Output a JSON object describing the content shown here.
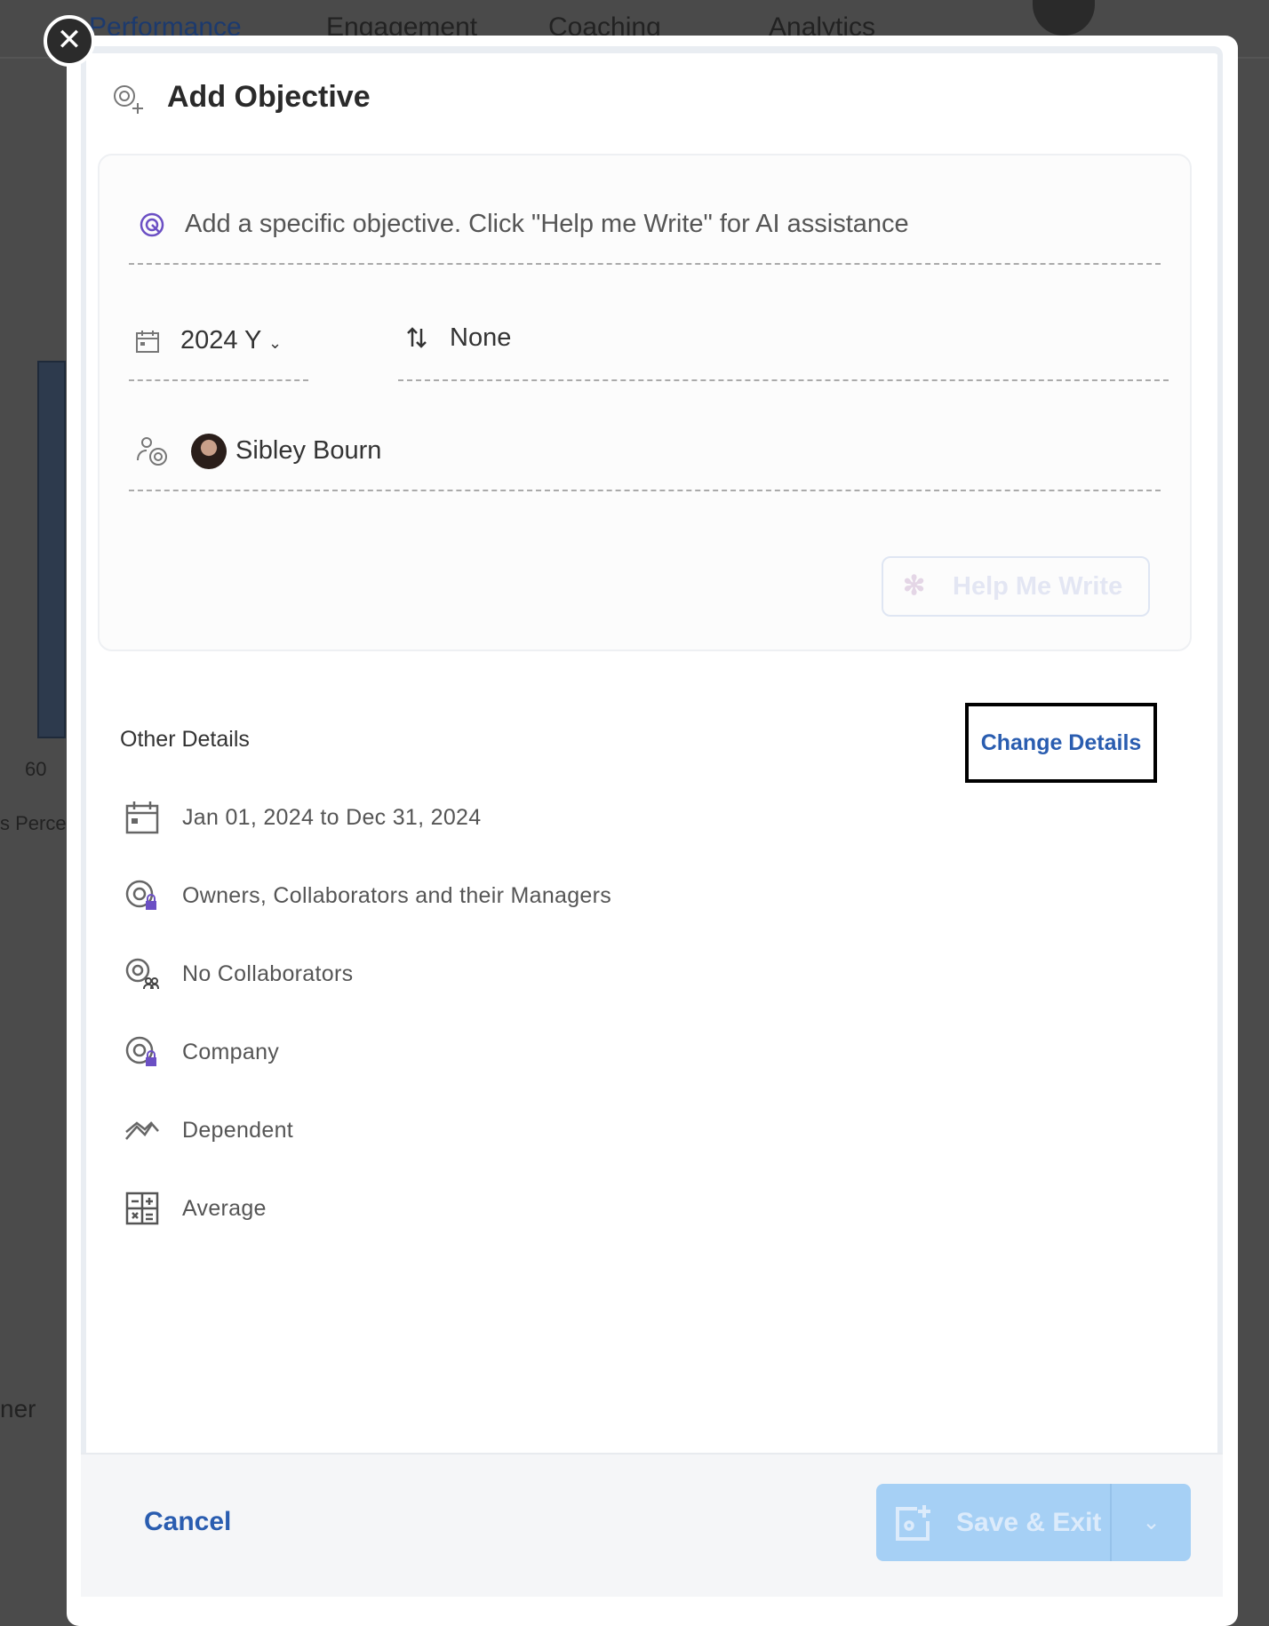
{
  "background": {
    "nav": [
      "Performance",
      "Engagement",
      "Coaching",
      "Analytics"
    ],
    "chart_tick": "60",
    "axis_fragment": "s Perce",
    "text_fragment": "ner"
  },
  "modal": {
    "title": "Add Objective",
    "close_icon": "close-icon",
    "objective_placeholder": "Add a specific objective.  Click \"Help me Write\" for AI assistance",
    "period": "2024 Y",
    "alignment": "None",
    "owner": "Sibley Bourn",
    "help_me_write": "Help Me Write",
    "other_details_label": "Other Details",
    "change_details": "Change Details",
    "details": [
      {
        "icon": "calendar-icon",
        "text": "Jan 01, 2024 to Dec 31, 2024"
      },
      {
        "icon": "target-lock-icon",
        "text": "Owners, Collaborators and their Managers"
      },
      {
        "icon": "target-people-icon",
        "text": "No Collaborators"
      },
      {
        "icon": "target-lock-icon",
        "text": "Company"
      },
      {
        "icon": "trend-icon",
        "text": "Dependent"
      },
      {
        "icon": "calculator-icon",
        "text": "Average"
      }
    ],
    "cancel": "Cancel",
    "save_exit": "Save & Exit"
  },
  "colors": {
    "accent": "#2a5db0",
    "ai_icon": "#6b4fc4",
    "save_disabled": "#a6d0f5"
  }
}
